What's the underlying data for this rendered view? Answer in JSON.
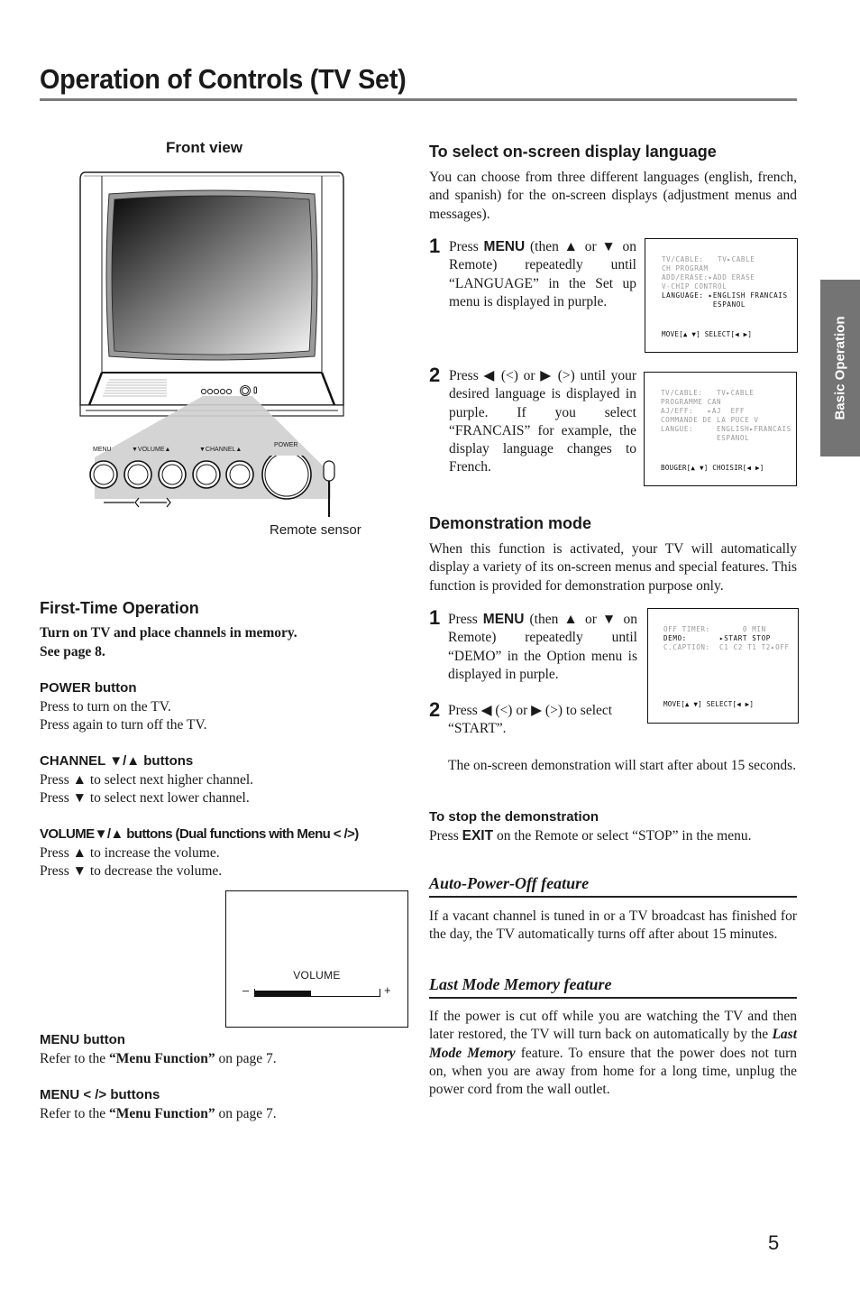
{
  "page": {
    "title": "Operation of Controls (TV Set)",
    "side_tab": "Basic Operation",
    "page_number": "5"
  },
  "front_view": {
    "heading": "Front view",
    "labels": {
      "menu": "MENU",
      "volume": "▼VOLUME▲",
      "channel": "▼CHANNEL▲",
      "power": "POWER",
      "arrow_left": "‹",
      "arrow_right": "›"
    },
    "remote_sensor": "Remote sensor"
  },
  "first_time": {
    "heading": "First-Time Operation",
    "intro_line1": "Turn on TV and place channels in memory.",
    "intro_line2": "See page 8.",
    "sections": [
      {
        "heading": "POWER  button",
        "lines": [
          "Press to turn on the TV.",
          "Press again to turn off the TV."
        ]
      },
      {
        "heading": "CHANNEL ▼/▲ buttons",
        "lines": [
          "Press ▲ to select next higher channel.",
          "Press ▼ to select next lower channel."
        ]
      },
      {
        "heading": "VOLUME▼/▲ buttons (Dual functions with Menu < />)",
        "lines": [
          "Press ▲ to increase the volume.",
          "Press ▼ to decrease the volume."
        ]
      },
      {
        "heading": "MENU button",
        "pre": "Refer to the ",
        "bold": "“Menu Function”",
        "post": " on page 7."
      },
      {
        "heading": "MENU < /> buttons",
        "pre": "Refer to the ",
        "bold": "“Menu Function”",
        "post": " on page 7."
      }
    ],
    "volume_osd": {
      "label": "VOLUME",
      "minus": "–",
      "plus": "+",
      "level_fraction": 0.45
    }
  },
  "language": {
    "heading": "To select on-screen display language",
    "intro": "You can choose from three different languages (english, french, and spanish) for the on-screen displays (adjustment menus and messages).",
    "step1": {
      "num": "1",
      "pre": "Press ",
      "bold": "MENU",
      "post": " (then ▲ or ▼ on Remote) repeatedly until “LANGUAGE” in the Set up menu is displayed in purple."
    },
    "step2": {
      "num": "2",
      "text": "Press ◀ (<) or ▶ (>) until your desired language is displayed in purple. If you select “FRANCAIS” for example, the display language changes to French."
    },
    "osd1": {
      "lines": [
        {
          "text": "TV/CABLE:   TV▸CABLE",
          "active": false
        },
        {
          "text": "CH PROGRAM",
          "active": false
        },
        {
          "text": "ADD/ERASE:▸ADD ERASE",
          "active": false
        },
        {
          "text": "V-CHIP CONTROL",
          "active": false
        },
        {
          "text": "LANGUAGE: ▸ENGLISH FRANCAIS",
          "active": true
        },
        {
          "text": "           ESPANOL",
          "active": true
        }
      ],
      "footer": "MOVE[▲ ▼] SELECT[◀ ▶]"
    },
    "osd2": {
      "lines": [
        {
          "text": "TV/CABLE:   TV▸CABLE",
          "active": false
        },
        {
          "text": "PROGRAMME CAN",
          "active": false
        },
        {
          "text": "AJ/EFF:   ▸AJ  EFF",
          "active": false
        },
        {
          "text": "COMMANDE DE LA PUCE V",
          "active": false
        },
        {
          "text": "LANGUE:     ENGLISH▸FRANCAIS",
          "active": false
        },
        {
          "text": "            ESPANOL",
          "active": false
        }
      ],
      "footer": "BOUGER[▲ ▼] CHOISIR[◀ ▶]"
    }
  },
  "demo": {
    "heading": "Demonstration mode",
    "intro": "When this function is activated, your TV will automatically display a variety of its on-screen menus and special features. This function is provided for demonstration purpose only.",
    "step1": {
      "num": "1",
      "pre": "Press ",
      "bold": "MENU",
      "post": " (then ▲ or ▼ on Remote) repeatedly until “DEMO” in the Option menu is displayed in purple."
    },
    "step2": {
      "num": "2",
      "text": "Press  ◀ (<) or ▶ (>) to select “START”."
    },
    "note": "The on-screen demonstration will start after about 15 seconds.",
    "osd": {
      "lines": [
        {
          "text": "OFF TIMER:       0 MIN",
          "active": false
        },
        {
          "text": "DEMO:       ▸START STOP",
          "active": true
        },
        {
          "text": "C.CAPTION:  C1 C2 T1 T2▸OFF",
          "active": false
        }
      ],
      "footer": "MOVE[▲ ▼] SELECT[◀ ▶]"
    },
    "stop_heading": "To stop the demonstration",
    "stop_pre": "Press ",
    "stop_bold": "EXIT",
    "stop_post": " on the Remote or select “STOP” in the menu."
  },
  "auto_power_off": {
    "heading": "Auto-Power-Off feature",
    "text": "If a vacant channel is tuned in or a TV broadcast has finished for the day, the TV automatically turns off after about 15 minutes."
  },
  "last_mode": {
    "heading": "Last Mode Memory feature",
    "pre": "If the power is cut off while you are watching the TV and then later restored, the TV will turn back on automatically by the ",
    "bold": "Last Mode Memory",
    "post": " feature. To ensure that the power does not turn on, when you are away from home for a long time, unplug the power cord from the wall outlet."
  }
}
